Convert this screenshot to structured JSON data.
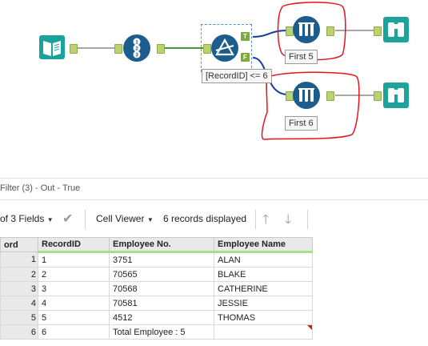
{
  "canvas": {
    "filter_expression": "[RecordID] <= 6",
    "filter_anchor_true": "T",
    "filter_anchor_false": "F",
    "sample_top_label": "First 5",
    "sample_bottom_label": "First 6",
    "record_id_icon_digits": [
      "1",
      "2",
      "3"
    ],
    "colors": {
      "tool_blue": "#1c5d8e",
      "browse_teal": "#1ea39a",
      "input_teal": "#1ba29c",
      "connection_green": "#3a9d3a",
      "connection_blue": "#1a3a9c",
      "highlight_red": "#e8141c"
    }
  },
  "results": {
    "title": "Filter (3) - Out - True"
  },
  "toolbar": {
    "fields_select": "of 3 Fields",
    "cell_viewer": "Cell Viewer",
    "records_displayed": "6 records displayed"
  },
  "grid": {
    "headers": [
      "ord",
      "RecordID",
      "Employee No.",
      "Employee Name"
    ],
    "rows": [
      {
        "num": "1",
        "record_id": "1",
        "employee_no": "3751",
        "employee_name": "ALAN"
      },
      {
        "num": "2",
        "record_id": "2",
        "employee_no": "70565",
        "employee_name": "BLAKE"
      },
      {
        "num": "3",
        "record_id": "3",
        "employee_no": "70568",
        "employee_name": "CATHERINE"
      },
      {
        "num": "4",
        "record_id": "4",
        "employee_no": "70581",
        "employee_name": "JESSIE"
      },
      {
        "num": "5",
        "record_id": "5",
        "employee_no": "4512",
        "employee_name": "THOMAS"
      },
      {
        "num": "6",
        "record_id": "6",
        "employee_no": "Total Employee : 5",
        "employee_name": ""
      }
    ]
  }
}
